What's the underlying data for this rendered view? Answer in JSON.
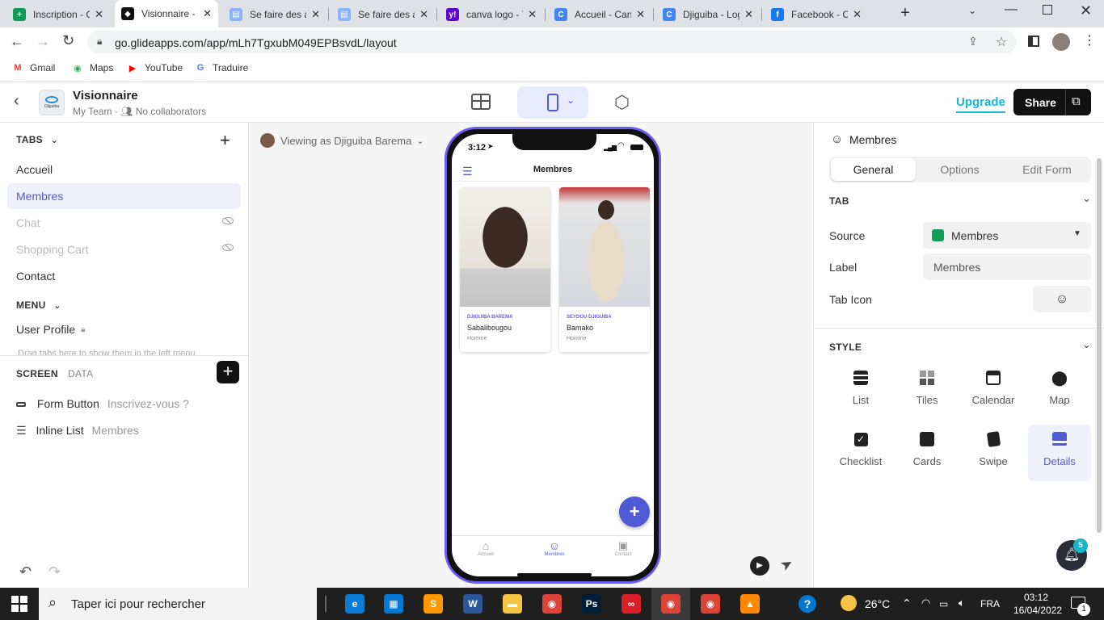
{
  "browser": {
    "tabs": [
      {
        "title": "Inscription - G",
        "favicon_color": "#0f9d58",
        "favicon": "+"
      },
      {
        "title": "Visionnaire - G",
        "favicon_color": "#111111",
        "favicon": "◆",
        "active": true
      },
      {
        "title": "Se faire des a",
        "favicon_color": "#8ab4f8",
        "favicon": "▤"
      },
      {
        "title": "Se faire des a",
        "favicon_color": "#8ab4f8",
        "favicon": "▤"
      },
      {
        "title": "canva logo - Y",
        "favicon_color": "#6001d2",
        "favicon": "y!"
      },
      {
        "title": "Accueil - Can",
        "favicon_color": "#4285f4",
        "favicon": "C"
      },
      {
        "title": "Djiguiba - Log",
        "favicon_color": "#4285f4",
        "favicon": "C"
      },
      {
        "title": "Facebook - C",
        "favicon_color": "#1877f2",
        "favicon": "f"
      }
    ],
    "new_tab": "+",
    "url": "go.glideapps.com/app/mLh7TgxubM049EPBsvdL/layout",
    "bookmarks": [
      {
        "label": "Gmail",
        "icon_color": "#ea4335",
        "icon": "M"
      },
      {
        "label": "Maps",
        "icon_color": "#34a853",
        "icon": "◉"
      },
      {
        "label": "YouTube",
        "icon_color": "#ff0000",
        "icon": "▶"
      },
      {
        "label": "Traduire",
        "icon_color": "#4285f4",
        "icon": "G"
      }
    ]
  },
  "app": {
    "name": "Visionnaire",
    "team": "My Team",
    "collaborators": "No collaborators",
    "logo_text": "Djiguiba",
    "upgrade_label": "Upgrade",
    "share_label": "Share",
    "accent": "#4f5bd5",
    "upgrade_color": "#15b8e0"
  },
  "left": {
    "tabs_header": "TABS",
    "tabs": [
      {
        "label": "Accueil",
        "state": "normal"
      },
      {
        "label": "Membres",
        "state": "selected"
      },
      {
        "label": "Chat",
        "state": "hidden"
      },
      {
        "label": "Shopping Cart",
        "state": "hidden"
      },
      {
        "label": "Contact",
        "state": "normal"
      }
    ],
    "menu_header": "MENU",
    "menu_items": [
      {
        "label": "User Profile"
      }
    ],
    "drag_hint": "Drag tabs here to show them in the left menu",
    "screen_tab": "SCREEN",
    "data_tab": "DATA",
    "components": [
      {
        "name": "Form Button",
        "detail": "Inscrivez-vous ?"
      },
      {
        "name": "Inline List",
        "detail": "Membres"
      }
    ]
  },
  "canvas": {
    "viewing_as": "Viewing as Djiguiba Barema",
    "phone": {
      "time": "3:12",
      "screen_title": "Membres",
      "cards": [
        {
          "title": "DJIGUIBA BAREMA",
          "place": "Sabalibougou",
          "gender": "Homme"
        },
        {
          "title": "SEYDOU DJIGUIBA",
          "place": "Bamako",
          "gender": "Homme"
        }
      ],
      "fab": "+",
      "nav": [
        {
          "label": "Accueil"
        },
        {
          "label": "Membres",
          "active": true
        },
        {
          "label": "Contact"
        }
      ]
    }
  },
  "right": {
    "title": "Membres",
    "segments": [
      "General",
      "Options",
      "Edit Form"
    ],
    "active_segment": "General",
    "tab_section": "TAB",
    "source_label": "Source",
    "source_value": "Membres",
    "label_label": "Label",
    "label_value": "Membres",
    "tab_icon_label": "Tab Icon",
    "style_section": "STYLE",
    "styles": [
      {
        "label": "List"
      },
      {
        "label": "Tiles"
      },
      {
        "label": "Calendar"
      },
      {
        "label": "Map"
      },
      {
        "label": "Checklist"
      },
      {
        "label": "Cards"
      },
      {
        "label": "Swipe"
      },
      {
        "label": "Details",
        "selected": true
      }
    ],
    "notification_count": "5"
  },
  "taskbar": {
    "search_placeholder": "Taper ici pour rechercher",
    "temperature": "26°C",
    "language": "FRA",
    "time": "03:12",
    "date": "16/04/2022",
    "notif_count": "1",
    "apps": [
      {
        "name": "edge",
        "color": "#0c7bd6",
        "glyph": "e"
      },
      {
        "name": "store",
        "color": "#0078d4",
        "glyph": "▦"
      },
      {
        "name": "sublime",
        "color": "#ff9800",
        "glyph": "S"
      },
      {
        "name": "word",
        "color": "#2b579a",
        "glyph": "W"
      },
      {
        "name": "explorer",
        "color": "#f4c542",
        "glyph": "▬"
      },
      {
        "name": "chrome",
        "color": "#db4437",
        "glyph": "◉"
      },
      {
        "name": "photoshop",
        "color": "#001e36",
        "glyph": "Ps"
      },
      {
        "name": "creative-cloud",
        "color": "#da1f26",
        "glyph": "∞"
      },
      {
        "name": "chrome-profile-1",
        "color": "#db4437",
        "glyph": "◉"
      },
      {
        "name": "chrome-profile-2",
        "color": "#db4437",
        "glyph": "◉"
      },
      {
        "name": "vlc",
        "color": "#ff8800",
        "glyph": "▲"
      }
    ]
  }
}
